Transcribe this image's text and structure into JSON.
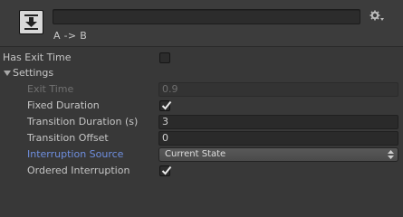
{
  "header": {
    "subtitle": "A -> B",
    "name_value": "",
    "icon": "transition-import-icon",
    "settings_icon": "gear-icon"
  },
  "has_exit_time": {
    "label": "Has Exit Time",
    "checked": false
  },
  "settings": {
    "label": "Settings",
    "expanded": true,
    "exit_time": {
      "label": "Exit Time",
      "value": "0.9",
      "disabled": true
    },
    "fixed_duration": {
      "label": "Fixed Duration",
      "checked": true
    },
    "transition_duration": {
      "label": "Transition Duration (s)",
      "value": "3"
    },
    "transition_offset": {
      "label": "Transition Offset",
      "value": "0"
    },
    "interruption_source": {
      "label": "Interruption Source",
      "value": "Current State"
    },
    "ordered_interruption": {
      "label": "Ordered Interruption",
      "checked": true
    }
  },
  "colors": {
    "background": "#383838",
    "link_label": "#6f8fe0",
    "text": "#c6c6c6",
    "disabled_text": "#717171"
  }
}
